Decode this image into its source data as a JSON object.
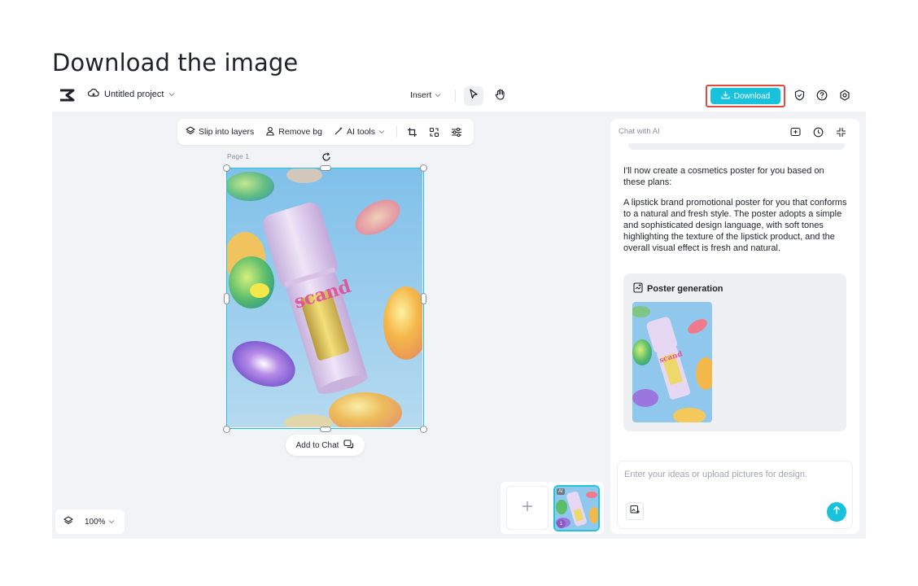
{
  "heading": "Download the image",
  "topbar": {
    "project_name": "Untitled project",
    "insert_label": "Insert",
    "download_label": "Download"
  },
  "toolbar": {
    "slip_layers": "Slip into layers",
    "remove_bg": "Remove bg",
    "ai_tools": "AI tools"
  },
  "canvas": {
    "page_label": "Page 1",
    "add_to_chat": "Add to Chat",
    "zoom": "100%"
  },
  "pages": {
    "thumb_badge": "AI",
    "thumb_number": "1"
  },
  "chat": {
    "title": "Chat with AI",
    "message_intro": "I'll now create a cosmetics poster for you based on these plans:",
    "message_body": "A lipstick brand promotional poster for you that conforms to a natural and fresh style. The poster adopts a simple and sophisticated design language, with soft tones highlighting the texture of the lipstick product, and the overall visual effect is fresh and natural.",
    "card_title": "Poster generation",
    "input_placeholder": "Enter your ideas or upload pictures for design."
  },
  "product_text": "scand",
  "colors": {
    "accent": "#18c2dc",
    "highlight": "#e04a3f",
    "selection": "#23c4dc",
    "poster_bg": "#8fc8ec",
    "product": "#d8c6e6",
    "brand_text": "#e0579e"
  }
}
